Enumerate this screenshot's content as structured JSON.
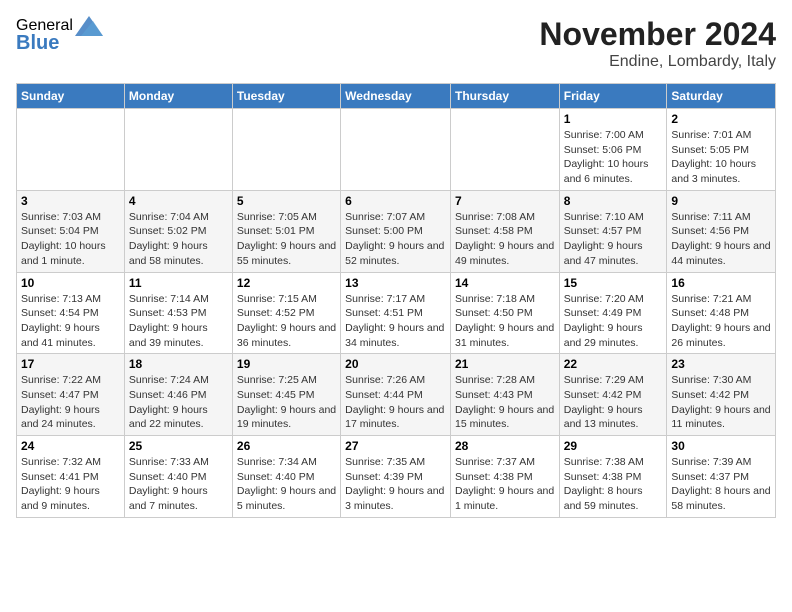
{
  "logo": {
    "general": "General",
    "blue": "Blue"
  },
  "title": "November 2024",
  "subtitle": "Endine, Lombardy, Italy",
  "days_of_week": [
    "Sunday",
    "Monday",
    "Tuesday",
    "Wednesday",
    "Thursday",
    "Friday",
    "Saturday"
  ],
  "weeks": [
    [
      {
        "day": "",
        "info": ""
      },
      {
        "day": "",
        "info": ""
      },
      {
        "day": "",
        "info": ""
      },
      {
        "day": "",
        "info": ""
      },
      {
        "day": "",
        "info": ""
      },
      {
        "day": "1",
        "info": "Sunrise: 7:00 AM\nSunset: 5:06 PM\nDaylight: 10 hours and 6 minutes."
      },
      {
        "day": "2",
        "info": "Sunrise: 7:01 AM\nSunset: 5:05 PM\nDaylight: 10 hours and 3 minutes."
      }
    ],
    [
      {
        "day": "3",
        "info": "Sunrise: 7:03 AM\nSunset: 5:04 PM\nDaylight: 10 hours and 1 minute."
      },
      {
        "day": "4",
        "info": "Sunrise: 7:04 AM\nSunset: 5:02 PM\nDaylight: 9 hours and 58 minutes."
      },
      {
        "day": "5",
        "info": "Sunrise: 7:05 AM\nSunset: 5:01 PM\nDaylight: 9 hours and 55 minutes."
      },
      {
        "day": "6",
        "info": "Sunrise: 7:07 AM\nSunset: 5:00 PM\nDaylight: 9 hours and 52 minutes."
      },
      {
        "day": "7",
        "info": "Sunrise: 7:08 AM\nSunset: 4:58 PM\nDaylight: 9 hours and 49 minutes."
      },
      {
        "day": "8",
        "info": "Sunrise: 7:10 AM\nSunset: 4:57 PM\nDaylight: 9 hours and 47 minutes."
      },
      {
        "day": "9",
        "info": "Sunrise: 7:11 AM\nSunset: 4:56 PM\nDaylight: 9 hours and 44 minutes."
      }
    ],
    [
      {
        "day": "10",
        "info": "Sunrise: 7:13 AM\nSunset: 4:54 PM\nDaylight: 9 hours and 41 minutes."
      },
      {
        "day": "11",
        "info": "Sunrise: 7:14 AM\nSunset: 4:53 PM\nDaylight: 9 hours and 39 minutes."
      },
      {
        "day": "12",
        "info": "Sunrise: 7:15 AM\nSunset: 4:52 PM\nDaylight: 9 hours and 36 minutes."
      },
      {
        "day": "13",
        "info": "Sunrise: 7:17 AM\nSunset: 4:51 PM\nDaylight: 9 hours and 34 minutes."
      },
      {
        "day": "14",
        "info": "Sunrise: 7:18 AM\nSunset: 4:50 PM\nDaylight: 9 hours and 31 minutes."
      },
      {
        "day": "15",
        "info": "Sunrise: 7:20 AM\nSunset: 4:49 PM\nDaylight: 9 hours and 29 minutes."
      },
      {
        "day": "16",
        "info": "Sunrise: 7:21 AM\nSunset: 4:48 PM\nDaylight: 9 hours and 26 minutes."
      }
    ],
    [
      {
        "day": "17",
        "info": "Sunrise: 7:22 AM\nSunset: 4:47 PM\nDaylight: 9 hours and 24 minutes."
      },
      {
        "day": "18",
        "info": "Sunrise: 7:24 AM\nSunset: 4:46 PM\nDaylight: 9 hours and 22 minutes."
      },
      {
        "day": "19",
        "info": "Sunrise: 7:25 AM\nSunset: 4:45 PM\nDaylight: 9 hours and 19 minutes."
      },
      {
        "day": "20",
        "info": "Sunrise: 7:26 AM\nSunset: 4:44 PM\nDaylight: 9 hours and 17 minutes."
      },
      {
        "day": "21",
        "info": "Sunrise: 7:28 AM\nSunset: 4:43 PM\nDaylight: 9 hours and 15 minutes."
      },
      {
        "day": "22",
        "info": "Sunrise: 7:29 AM\nSunset: 4:42 PM\nDaylight: 9 hours and 13 minutes."
      },
      {
        "day": "23",
        "info": "Sunrise: 7:30 AM\nSunset: 4:42 PM\nDaylight: 9 hours and 11 minutes."
      }
    ],
    [
      {
        "day": "24",
        "info": "Sunrise: 7:32 AM\nSunset: 4:41 PM\nDaylight: 9 hours and 9 minutes."
      },
      {
        "day": "25",
        "info": "Sunrise: 7:33 AM\nSunset: 4:40 PM\nDaylight: 9 hours and 7 minutes."
      },
      {
        "day": "26",
        "info": "Sunrise: 7:34 AM\nSunset: 4:40 PM\nDaylight: 9 hours and 5 minutes."
      },
      {
        "day": "27",
        "info": "Sunrise: 7:35 AM\nSunset: 4:39 PM\nDaylight: 9 hours and 3 minutes."
      },
      {
        "day": "28",
        "info": "Sunrise: 7:37 AM\nSunset: 4:38 PM\nDaylight: 9 hours and 1 minute."
      },
      {
        "day": "29",
        "info": "Sunrise: 7:38 AM\nSunset: 4:38 PM\nDaylight: 8 hours and 59 minutes."
      },
      {
        "day": "30",
        "info": "Sunrise: 7:39 AM\nSunset: 4:37 PM\nDaylight: 8 hours and 58 minutes."
      }
    ]
  ]
}
